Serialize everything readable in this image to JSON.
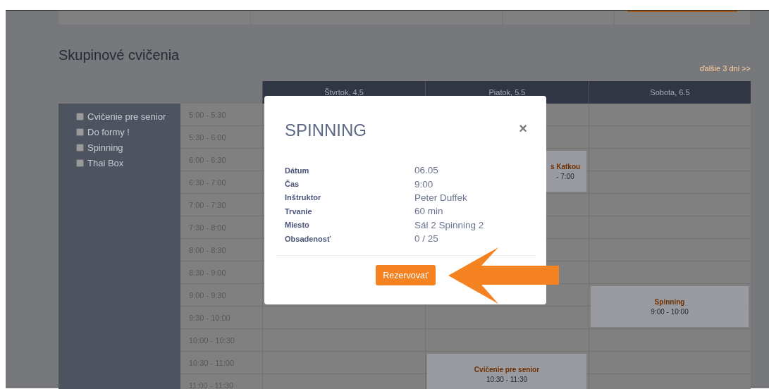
{
  "section_title": "Skupinové cvičenia",
  "next_link": "ďalšie 3 dni >>",
  "filters": [
    {
      "label": "Cvičenie pre senior",
      "checked": false
    },
    {
      "label": "Do formy !",
      "checked": false
    },
    {
      "label": "Spinning",
      "checked": false
    },
    {
      "label": "Thai Box",
      "checked": false
    }
  ],
  "days": [
    {
      "label": "Štvrtok, 4.5"
    },
    {
      "label": "Piatok, 5.5"
    },
    {
      "label": "Sobota, 6.5"
    }
  ],
  "rows": [
    {
      "time": "5:00 - 5:30",
      "cells": [
        {
          "kind": "empty"
        },
        {
          "kind": "empty"
        },
        {
          "kind": "empty"
        }
      ]
    },
    {
      "time": "5:30 - 6:00",
      "cells": [
        {
          "kind": "empty"
        },
        {
          "kind": "empty"
        },
        {
          "kind": "empty"
        }
      ]
    },
    {
      "time": "6:00 - 6:30",
      "cells": [
        {
          "kind": "empty"
        },
        {
          "kind": "event_partial",
          "title": "s Katkou",
          "time": "- 7:00"
        },
        {
          "kind": "empty"
        }
      ]
    },
    {
      "time": "6:30 - 7:00",
      "cells": [
        {
          "kind": "empty"
        },
        {
          "kind": "continued"
        },
        {
          "kind": "empty"
        }
      ]
    },
    {
      "time": "7:00 - 7:30",
      "cells": [
        {
          "kind": "empty"
        },
        {
          "kind": "empty"
        },
        {
          "kind": "empty"
        }
      ]
    },
    {
      "time": "7:30 - 8:00",
      "cells": [
        {
          "kind": "empty"
        },
        {
          "kind": "empty"
        },
        {
          "kind": "empty"
        }
      ]
    },
    {
      "time": "8:00 - 8:30",
      "cells": [
        {
          "kind": "empty"
        },
        {
          "kind": "empty"
        },
        {
          "kind": "empty"
        }
      ]
    },
    {
      "time": "8:30 - 9:00",
      "cells": [
        {
          "kind": "empty"
        },
        {
          "kind": "empty"
        },
        {
          "kind": "empty"
        }
      ]
    },
    {
      "time": "9:00 - 9:30",
      "cells": [
        {
          "kind": "empty"
        },
        {
          "kind": "empty"
        },
        {
          "kind": "event",
          "title": "Spinning",
          "time": "9:00 - 10:00"
        }
      ]
    },
    {
      "time": "9:30 - 10:00",
      "cells": [
        {
          "kind": "empty"
        },
        {
          "kind": "empty"
        },
        {
          "kind": "continued"
        }
      ]
    },
    {
      "time": "10:00 - 10:30",
      "cells": [
        {
          "kind": "empty"
        },
        {
          "kind": "empty"
        },
        {
          "kind": "empty"
        }
      ]
    },
    {
      "time": "10:30 - 11:00",
      "cells": [
        {
          "kind": "empty"
        },
        {
          "kind": "event",
          "title": "Cvičenie pre senior",
          "time": "10:30 - 11:30"
        },
        {
          "kind": "empty"
        }
      ]
    },
    {
      "time": "11:00 - 11:30",
      "cells": [
        {
          "kind": "empty"
        },
        {
          "kind": "continued"
        },
        {
          "kind": "empty"
        }
      ]
    }
  ],
  "modal": {
    "title": "SPINNING",
    "close": "×",
    "details": [
      {
        "label": "Dátum",
        "value": "06.05"
      },
      {
        "label": "Čas",
        "value": "9:00"
      },
      {
        "label": "Inštruktor",
        "value": "Peter Duffek"
      },
      {
        "label": "Trvanie",
        "value": "60 min"
      },
      {
        "label": "Miesto",
        "value": "Sál 2 Spinning 2"
      },
      {
        "label": "Obsadenosť",
        "value": "0 / 25"
      }
    ],
    "button": "Rezervovať"
  }
}
